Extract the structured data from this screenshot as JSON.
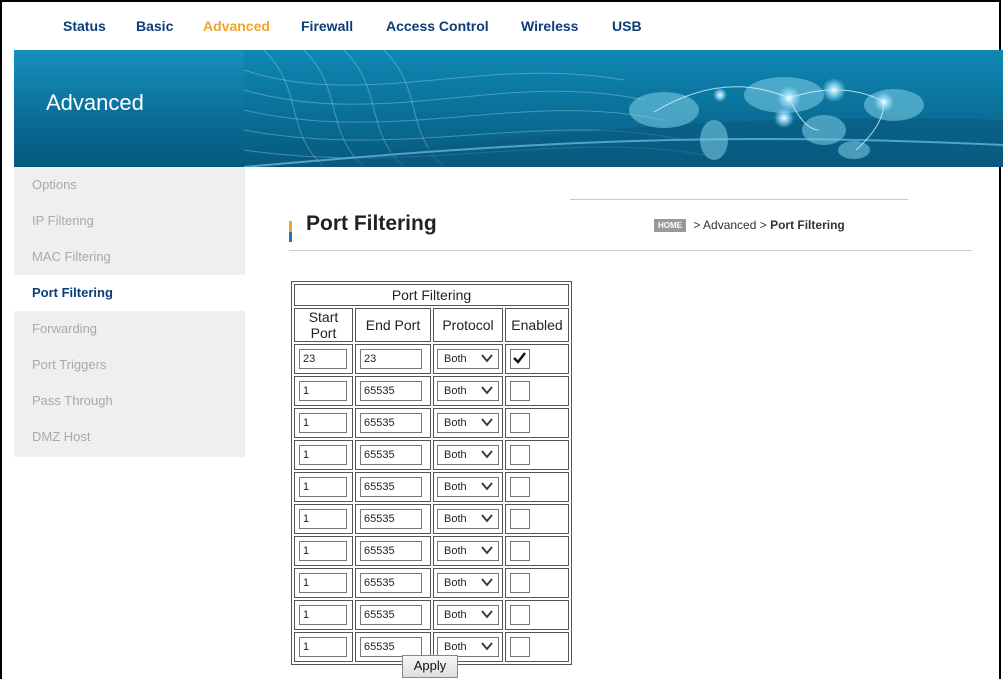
{
  "nav": {
    "items": [
      {
        "label": "Status"
      },
      {
        "label": "Basic"
      },
      {
        "label": "Advanced",
        "active": true
      },
      {
        "label": "Firewall"
      },
      {
        "label": "Access Control"
      },
      {
        "label": "Wireless"
      },
      {
        "label": "USB"
      }
    ],
    "active_color": "#f2a42a",
    "color": "#0b3e78"
  },
  "banner": {
    "title": "Advanced"
  },
  "sidebar": {
    "items": [
      {
        "label": "Options"
      },
      {
        "label": "IP Filtering"
      },
      {
        "label": "MAC Filtering"
      },
      {
        "label": "Port Filtering",
        "active": true
      },
      {
        "label": "Forwarding"
      },
      {
        "label": "Port Triggers"
      },
      {
        "label": "Pass Through"
      },
      {
        "label": "DMZ Host"
      }
    ]
  },
  "page": {
    "title": "Port Filtering",
    "breadcrumb": {
      "home": "HOME",
      "path": " > Advanced > ",
      "current": "Port Filtering"
    }
  },
  "table": {
    "caption": "Port Filtering",
    "headers": [
      "Start Port",
      "End Port",
      "Protocol",
      "Enabled"
    ],
    "rows": [
      {
        "start": "23",
        "end": "23",
        "protocol": "Both",
        "enabled": true
      },
      {
        "start": "1",
        "end": "65535",
        "protocol": "Both",
        "enabled": false
      },
      {
        "start": "1",
        "end": "65535",
        "protocol": "Both",
        "enabled": false
      },
      {
        "start": "1",
        "end": "65535",
        "protocol": "Both",
        "enabled": false
      },
      {
        "start": "1",
        "end": "65535",
        "protocol": "Both",
        "enabled": false
      },
      {
        "start": "1",
        "end": "65535",
        "protocol": "Both",
        "enabled": false
      },
      {
        "start": "1",
        "end": "65535",
        "protocol": "Both",
        "enabled": false
      },
      {
        "start": "1",
        "end": "65535",
        "protocol": "Both",
        "enabled": false
      },
      {
        "start": "1",
        "end": "65535",
        "protocol": "Both",
        "enabled": false
      },
      {
        "start": "1",
        "end": "65535",
        "protocol": "Both",
        "enabled": false
      }
    ]
  },
  "apply_label": "Apply"
}
